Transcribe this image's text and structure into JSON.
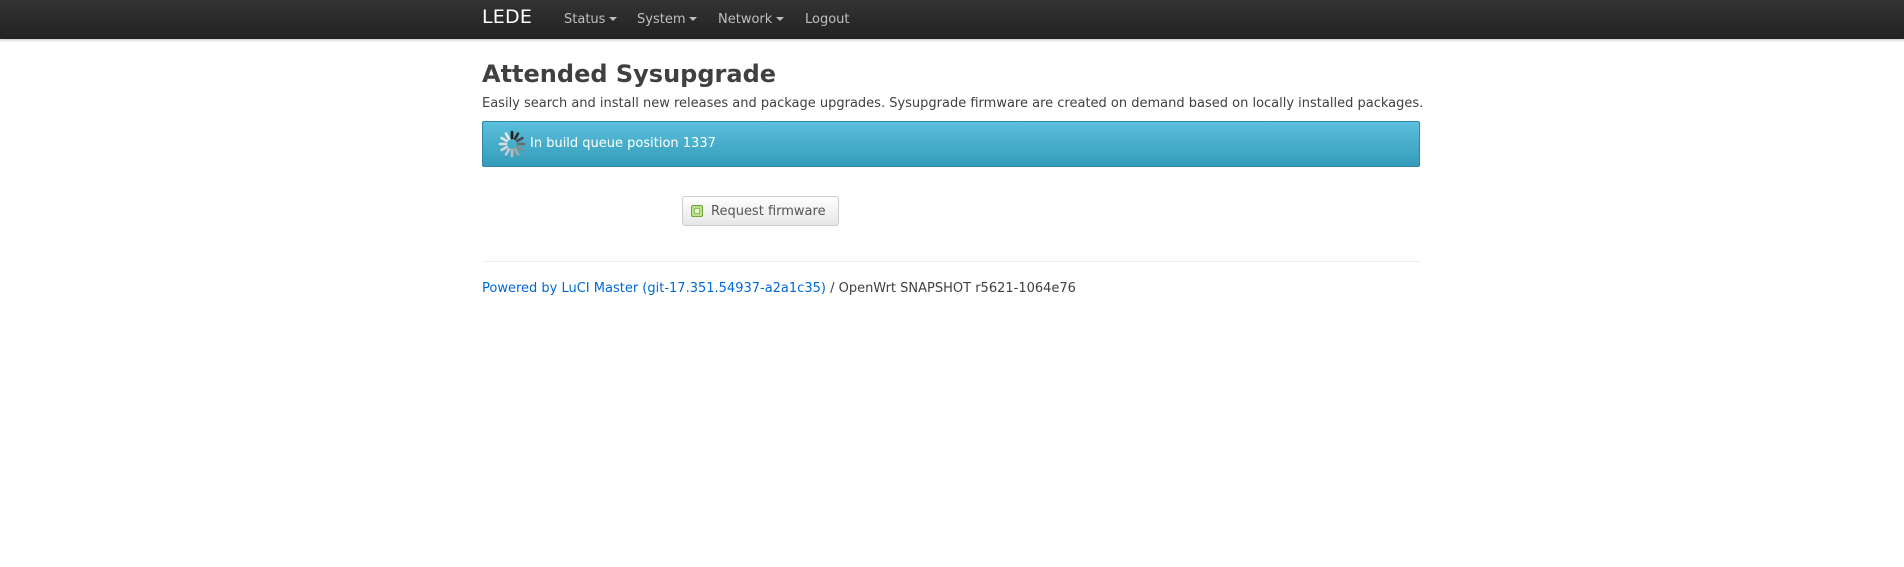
{
  "header": {
    "brand": "LEDE",
    "nav": [
      {
        "label": "Status",
        "has_dropdown": true
      },
      {
        "label": "System",
        "has_dropdown": true
      },
      {
        "label": "Network",
        "has_dropdown": true
      },
      {
        "label": "Logout",
        "has_dropdown": false
      }
    ]
  },
  "main": {
    "title": "Attended Sysupgrade",
    "description": "Easily search and install new releases and package upgrades. Sysupgrade firmware are created on demand based on locally installed packages.",
    "status_alert": {
      "text": "In build queue position 1337",
      "icon": "loading-spinner-icon",
      "color": "#5bc0de"
    },
    "request_button": {
      "label": "Request firmware",
      "icon": "apply-icon"
    }
  },
  "footer": {
    "link_text": "Powered by LuCI Master (git-17.351.54937-a2a1c35)",
    "version_text": "/ OpenWrt SNAPSHOT r5621-1064e76",
    "link_color": "#0069d6"
  }
}
